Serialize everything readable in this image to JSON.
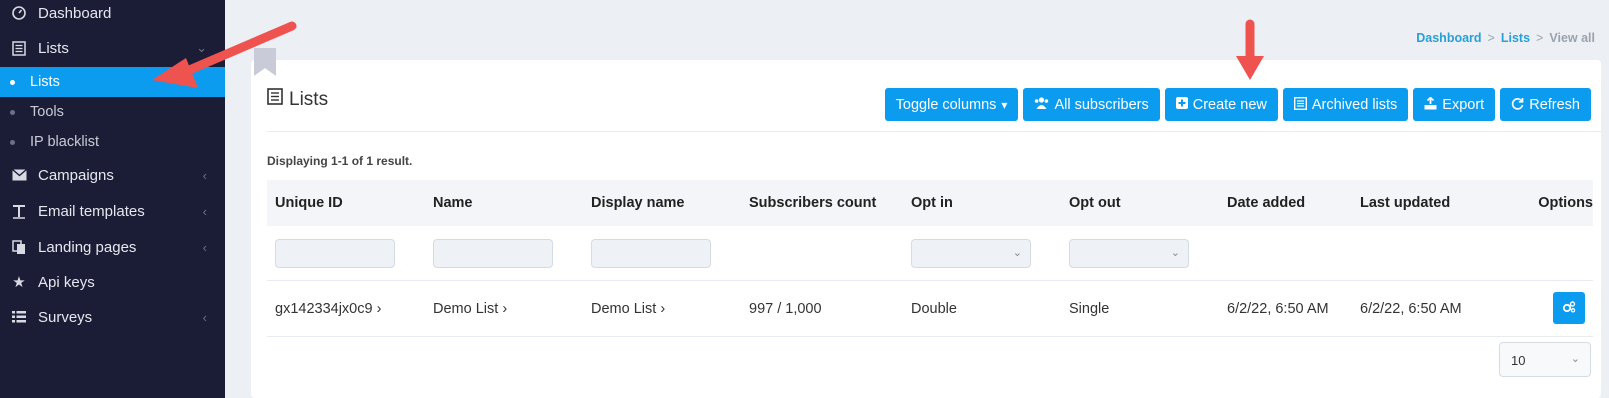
{
  "sidebar": {
    "items": [
      {
        "label": "Dashboard",
        "icon": "dashboard-icon"
      },
      {
        "label": "Lists",
        "icon": "list-icon"
      },
      {
        "label": "Campaigns",
        "icon": "envelope-icon"
      },
      {
        "label": "Email templates",
        "icon": "text-icon"
      },
      {
        "label": "Landing pages",
        "icon": "copy-icon"
      },
      {
        "label": "Api keys",
        "icon": "star-icon"
      },
      {
        "label": "Surveys",
        "icon": "list-ul-icon"
      }
    ],
    "subitems": [
      {
        "label": "Lists"
      },
      {
        "label": "Tools"
      },
      {
        "label": "IP blacklist"
      }
    ]
  },
  "breadcrumb": {
    "items": [
      "Dashboard",
      "Lists"
    ],
    "current": "View all",
    "separator": ">"
  },
  "page": {
    "title": "Lists",
    "summary": "Displaying 1-1 of 1 result."
  },
  "toolbar": {
    "toggle_columns": "Toggle columns",
    "all_subscribers": "All subscribers",
    "create_new": "Create new",
    "archived_lists": "Archived lists",
    "export": "Export",
    "refresh": "Refresh"
  },
  "table": {
    "columns": [
      "Unique ID",
      "Name",
      "Display name",
      "Subscribers count",
      "Opt in",
      "Opt out",
      "Date added",
      "Last updated",
      "Options"
    ],
    "rows": [
      {
        "unique_id": "gx142334jx0c9",
        "name": "Demo List",
        "display_name": "Demo List",
        "subscribers_count": "997 / 1,000",
        "opt_in": "Double",
        "opt_out": "Single",
        "date_added": "6/2/22, 6:50 AM",
        "last_updated": "6/2/22, 6:50 AM"
      }
    ]
  },
  "pagination": {
    "page_size": "10"
  },
  "colors": {
    "accent": "#0b9bef",
    "sidebar_bg": "#1b1d36",
    "annotation_arrow": "#ef5350"
  }
}
